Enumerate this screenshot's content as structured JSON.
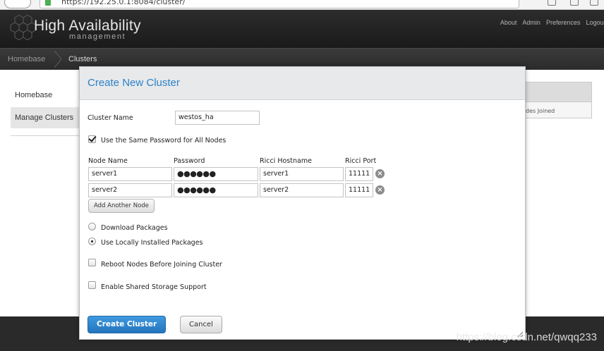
{
  "browser": {
    "url": "https://192.25.0.1:8084/cluster/"
  },
  "app": {
    "brand_title": "High Availability",
    "brand_subtitle": "management",
    "top_links": [
      "About",
      "Admin",
      "Preferences",
      "Logout"
    ]
  },
  "breadcrumb": {
    "items": [
      "Homebase",
      "Clusters"
    ]
  },
  "sidebar": {
    "items": [
      "Homebase",
      "Manage Clusters"
    ]
  },
  "background_table": {
    "partial_header": "des Joined"
  },
  "modal": {
    "title": "Create New Cluster",
    "cluster_name_label": "Cluster Name",
    "cluster_name_value": "westos_ha",
    "same_password_label": "Use the Same Password for All Nodes",
    "same_password_checked": true,
    "columns": [
      "Node Name",
      "Password",
      "Ricci Hostname",
      "Ricci Port"
    ],
    "nodes": [
      {
        "name": "server1",
        "password": "●●●●●●",
        "hostname": "server1",
        "port": "11111"
      },
      {
        "name": "server2",
        "password": "●●●●●●",
        "hostname": "server2",
        "port": "11111"
      }
    ],
    "add_node_label": "Add Another Node",
    "download_packages_label": "Download Packages",
    "local_packages_label": "Use Locally Installed Packages",
    "package_option_selected": "local",
    "reboot_label": "Reboot Nodes Before Joining Cluster",
    "shared_storage_label": "Enable Shared Storage Support",
    "create_button_label": "Create Cluster",
    "cancel_button_label": "Cancel"
  },
  "watermark": "https://blog.csdn.net/qwqq233",
  "colors": {
    "accent": "#2d82c8",
    "primary_button": "#2474bd",
    "header_bg": "#1f1f1f"
  }
}
